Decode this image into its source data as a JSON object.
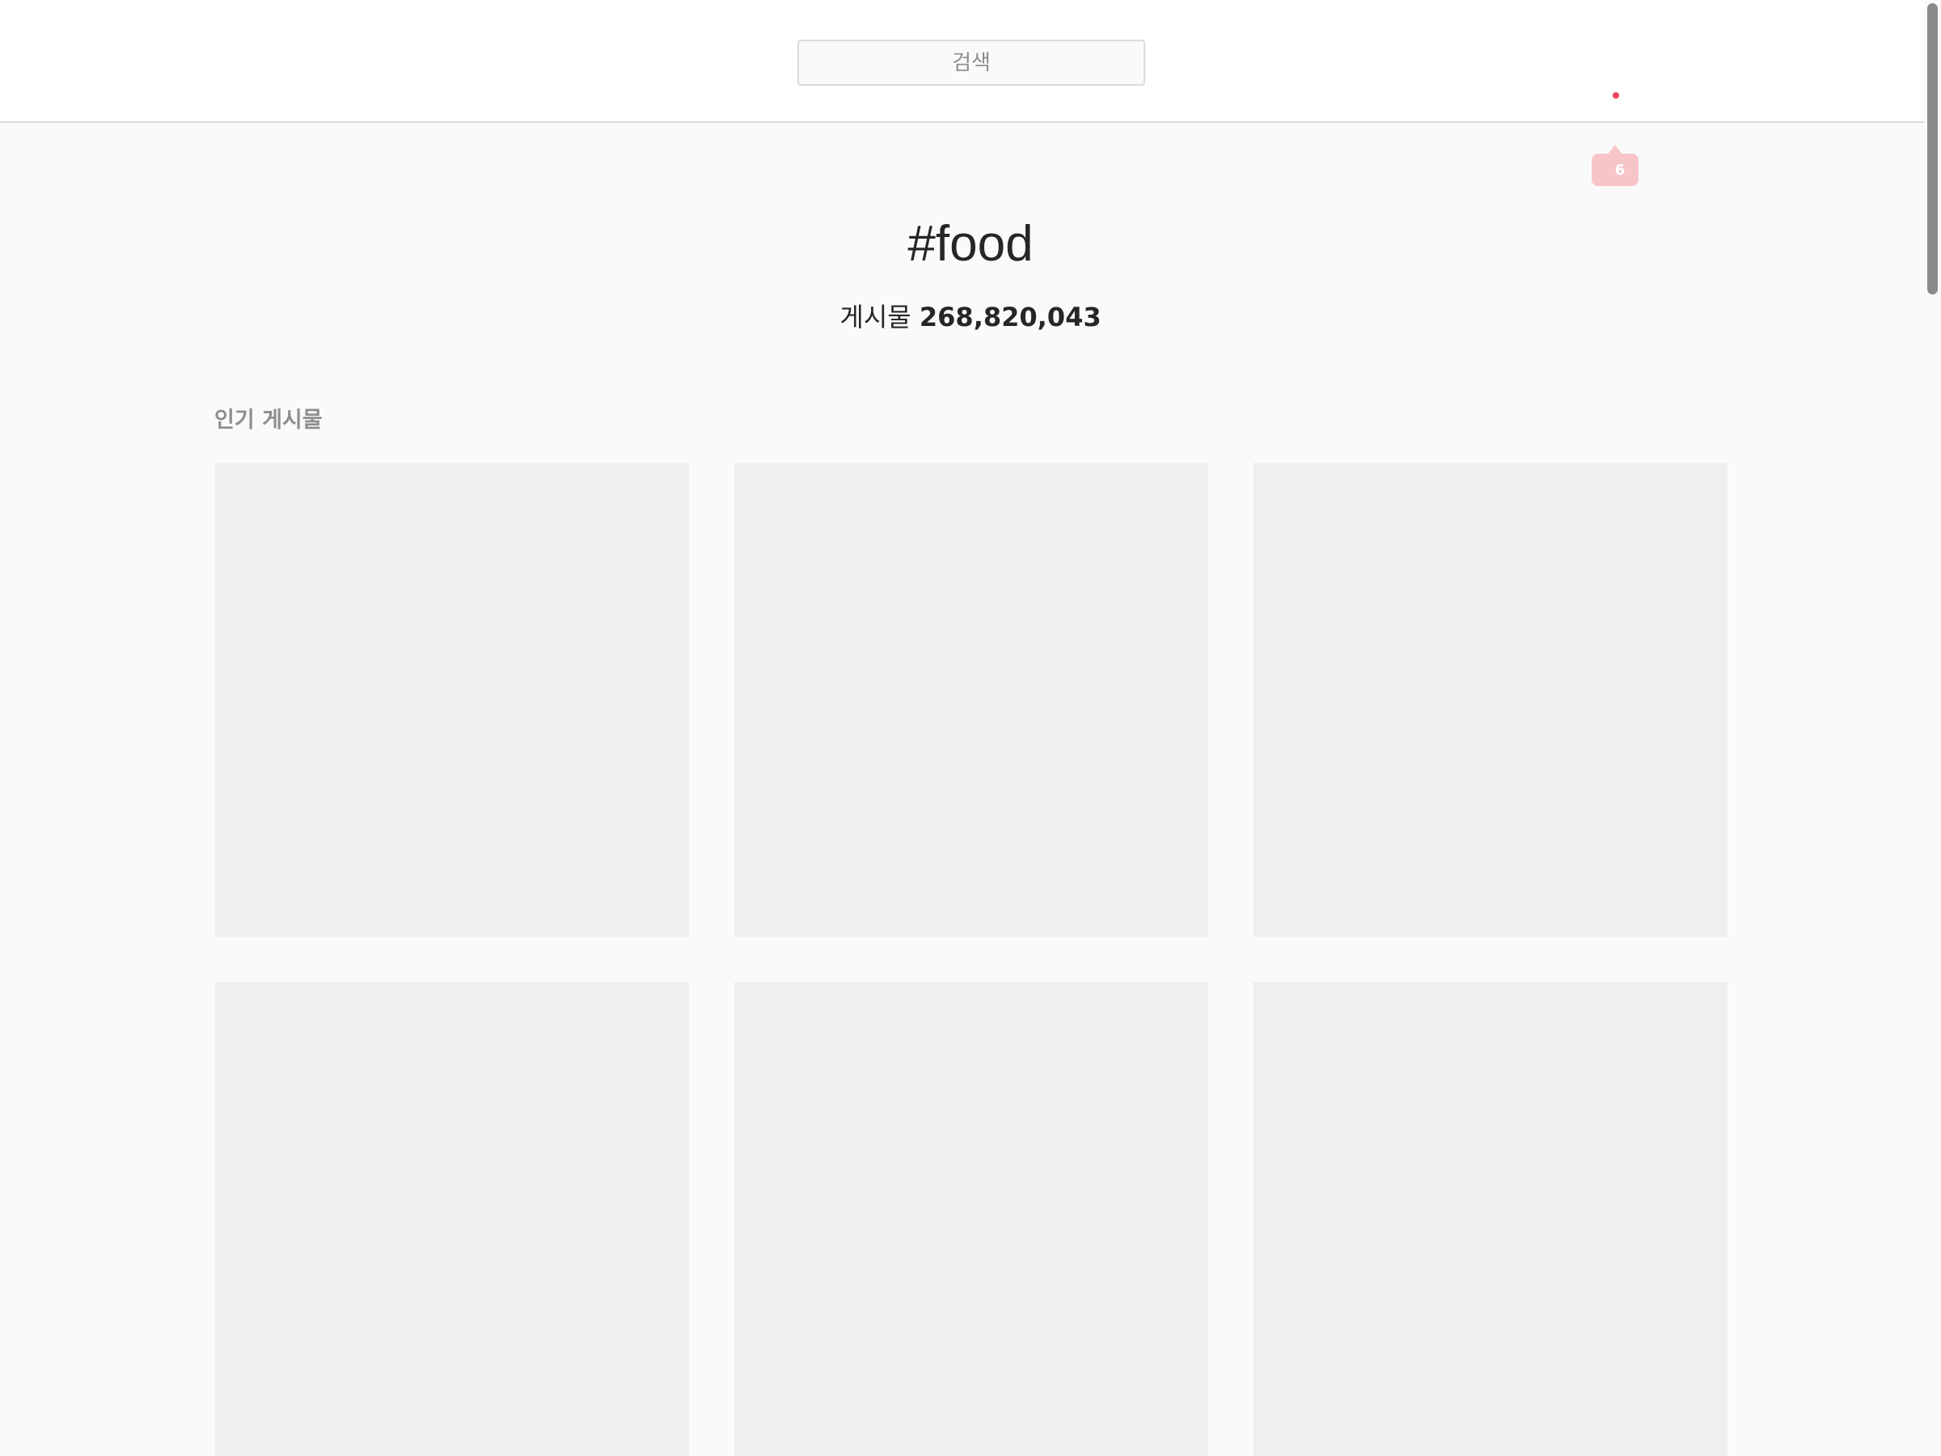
{
  "search": {
    "placeholder": "검색"
  },
  "notifications": {
    "count": "6"
  },
  "hashtag": {
    "title": "#food",
    "posts_label": "게시물",
    "posts_count": "268,820,043"
  },
  "top_posts": {
    "heading": "인기 게시물",
    "tiles": [
      "",
      "",
      "",
      "",
      "",
      ""
    ]
  },
  "colors": {
    "background": "#fafafa",
    "header": "#ffffff",
    "tile_placeholder": "#efefef",
    "notification_dot": "#ed4956",
    "notification_bubble": "#f7c5c8"
  }
}
